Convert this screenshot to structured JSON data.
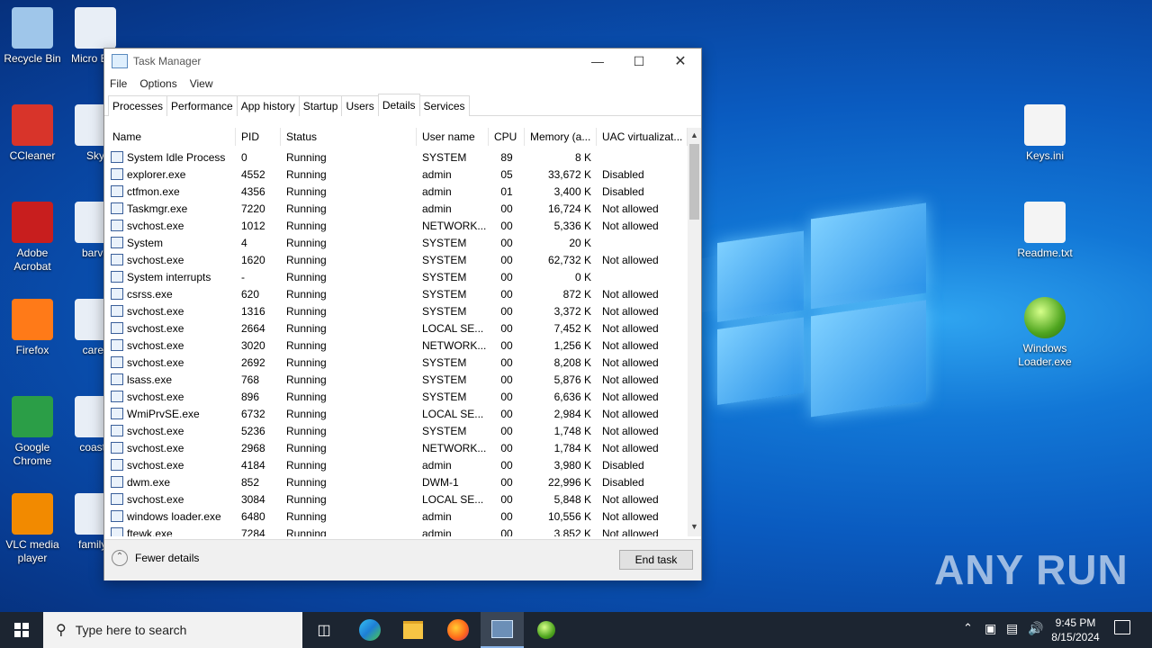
{
  "desktop_icons_left": [
    {
      "label": "Recycle Bin",
      "icon": "recycle-bin-icon",
      "color": "#9fc6ea"
    },
    {
      "label": "CCleaner",
      "icon": "ccleaner-icon",
      "color": "#d8342a"
    },
    {
      "label": "Adobe Acrobat",
      "icon": "acrobat-icon",
      "color": "#c81e1e"
    },
    {
      "label": "Firefox",
      "icon": "firefox-icon",
      "color": "#ff7a18"
    },
    {
      "label": "Google Chrome",
      "icon": "chrome-icon",
      "color": "#2b9e47"
    },
    {
      "label": "VLC media player",
      "icon": "vlc-icon",
      "color": "#f28a00"
    }
  ],
  "desktop_icons_second_col": [
    {
      "label": "Micro Edg",
      "icon": "edge-icon"
    },
    {
      "label": "Sky",
      "icon": "skype-icon"
    },
    {
      "label": "barva",
      "icon": "image-file-icon"
    },
    {
      "label": "carell",
      "icon": "word-doc-icon"
    },
    {
      "label": "coastd",
      "icon": "word-doc-icon"
    },
    {
      "label": "familyp",
      "icon": "image-file-icon"
    }
  ],
  "desktop_icons_right": [
    {
      "label": "Keys.ini",
      "icon": "ini-file-icon"
    },
    {
      "label": "Readme.txt",
      "icon": "text-file-icon"
    },
    {
      "label": "Windows Loader.exe",
      "icon": "windows-loader-icon"
    }
  ],
  "task_manager": {
    "title": "Task Manager",
    "menu": [
      "File",
      "Options",
      "View"
    ],
    "tabs": [
      "Processes",
      "Performance",
      "App history",
      "Startup",
      "Users",
      "Details",
      "Services"
    ],
    "active_tab": "Details",
    "columns": [
      "Name",
      "PID",
      "Status",
      "User name",
      "CPU",
      "Memory (a...",
      "UAC virtualizat..."
    ],
    "rows": [
      [
        "System Idle Process",
        "0",
        "Running",
        "SYSTEM",
        "89",
        "8 K",
        ""
      ],
      [
        "explorer.exe",
        "4552",
        "Running",
        "admin",
        "05",
        "33,672 K",
        "Disabled"
      ],
      [
        "ctfmon.exe",
        "4356",
        "Running",
        "admin",
        "01",
        "3,400 K",
        "Disabled"
      ],
      [
        "Taskmgr.exe",
        "7220",
        "Running",
        "admin",
        "00",
        "16,724 K",
        "Not allowed"
      ],
      [
        "svchost.exe",
        "1012",
        "Running",
        "NETWORK...",
        "00",
        "5,336 K",
        "Not allowed"
      ],
      [
        "System",
        "4",
        "Running",
        "SYSTEM",
        "00",
        "20 K",
        ""
      ],
      [
        "svchost.exe",
        "1620",
        "Running",
        "SYSTEM",
        "00",
        "62,732 K",
        "Not allowed"
      ],
      [
        "System interrupts",
        "-",
        "Running",
        "SYSTEM",
        "00",
        "0 K",
        ""
      ],
      [
        "csrss.exe",
        "620",
        "Running",
        "SYSTEM",
        "00",
        "872 K",
        "Not allowed"
      ],
      [
        "svchost.exe",
        "1316",
        "Running",
        "SYSTEM",
        "00",
        "3,372 K",
        "Not allowed"
      ],
      [
        "svchost.exe",
        "2664",
        "Running",
        "LOCAL SE...",
        "00",
        "7,452 K",
        "Not allowed"
      ],
      [
        "svchost.exe",
        "3020",
        "Running",
        "NETWORK...",
        "00",
        "1,256 K",
        "Not allowed"
      ],
      [
        "svchost.exe",
        "2692",
        "Running",
        "SYSTEM",
        "00",
        "8,208 K",
        "Not allowed"
      ],
      [
        "lsass.exe",
        "768",
        "Running",
        "SYSTEM",
        "00",
        "5,876 K",
        "Not allowed"
      ],
      [
        "svchost.exe",
        "896",
        "Running",
        "SYSTEM",
        "00",
        "6,636 K",
        "Not allowed"
      ],
      [
        "WmiPrvSE.exe",
        "6732",
        "Running",
        "LOCAL SE...",
        "00",
        "2,984 K",
        "Not allowed"
      ],
      [
        "svchost.exe",
        "5236",
        "Running",
        "SYSTEM",
        "00",
        "1,748 K",
        "Not allowed"
      ],
      [
        "svchost.exe",
        "2968",
        "Running",
        "NETWORK...",
        "00",
        "1,784 K",
        "Not allowed"
      ],
      [
        "svchost.exe",
        "4184",
        "Running",
        "admin",
        "00",
        "3,980 K",
        "Disabled"
      ],
      [
        "dwm.exe",
        "852",
        "Running",
        "DWM-1",
        "00",
        "22,996 K",
        "Disabled"
      ],
      [
        "svchost.exe",
        "3084",
        "Running",
        "LOCAL SE...",
        "00",
        "5,848 K",
        "Not allowed"
      ],
      [
        "windows loader.exe",
        "6480",
        "Running",
        "admin",
        "00",
        "10,556 K",
        "Not allowed"
      ],
      [
        "ftewk.exe",
        "7284",
        "Running",
        "admin",
        "00",
        "3,852 K",
        "Not allowed"
      ]
    ],
    "fewer_details": "Fewer details",
    "end_task": "End task"
  },
  "taskbar": {
    "search_placeholder": "Type here to search",
    "time": "9:45 PM",
    "date": "8/15/2024"
  },
  "watermark": "ANY RUN"
}
